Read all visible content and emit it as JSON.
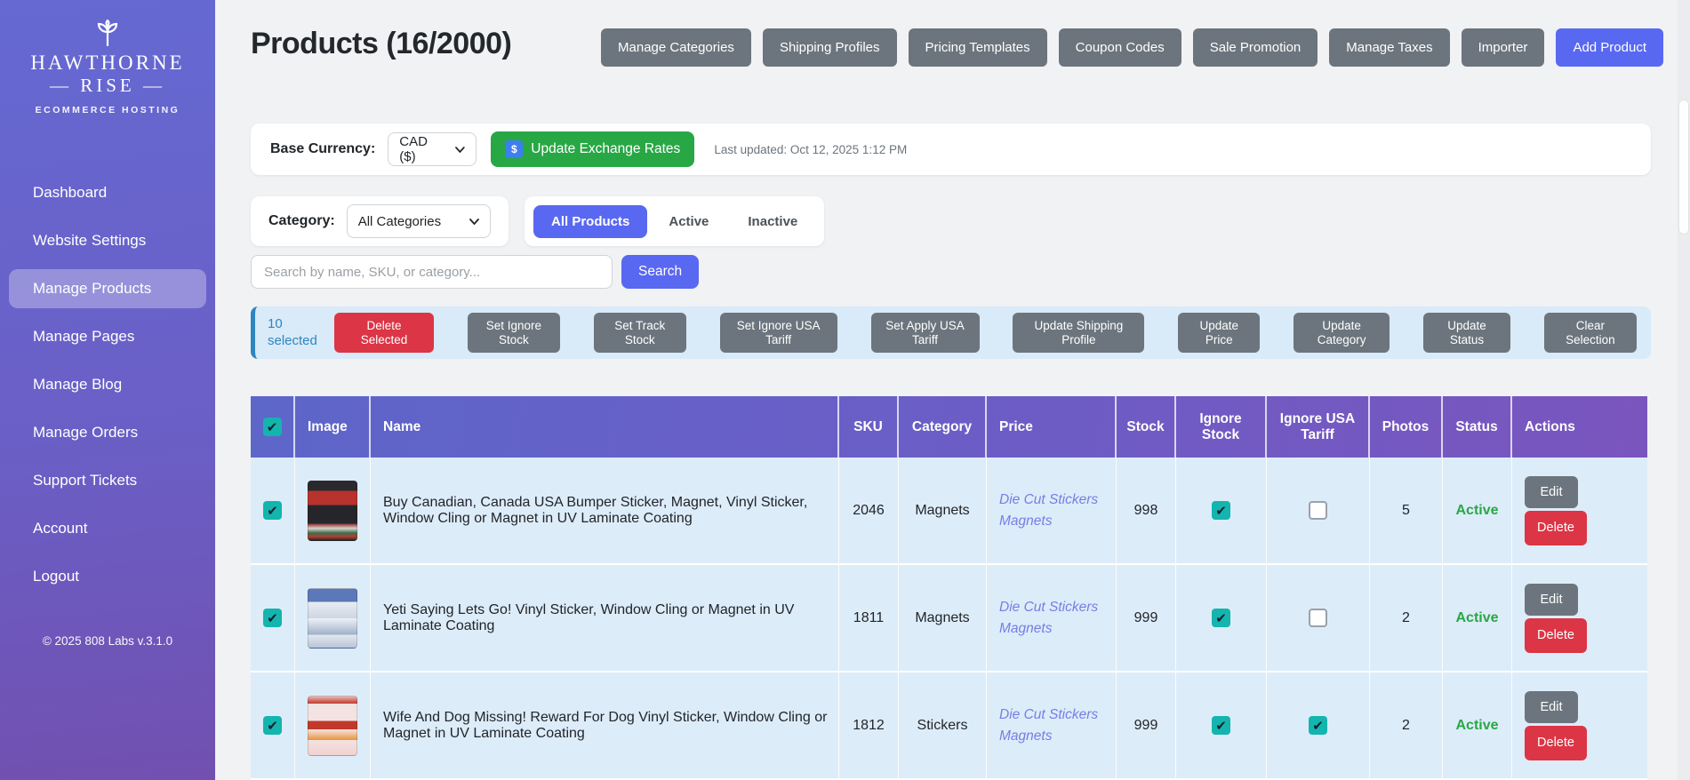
{
  "sidebar": {
    "logo": {
      "title_line1": "HAWTHORNE",
      "title_line2": "— RISE —",
      "subtitle": "ECOMMERCE HOSTING"
    },
    "items": [
      {
        "label": "Dashboard",
        "active": false
      },
      {
        "label": "Website Settings",
        "active": false
      },
      {
        "label": "Manage Products",
        "active": true
      },
      {
        "label": "Manage Pages",
        "active": false
      },
      {
        "label": "Manage Blog",
        "active": false
      },
      {
        "label": "Manage Orders",
        "active": false
      },
      {
        "label": "Support Tickets",
        "active": false
      },
      {
        "label": "Account",
        "active": false
      },
      {
        "label": "Logout",
        "active": false
      }
    ],
    "footer": "© 2025 808 Labs v.3.1.0"
  },
  "header": {
    "title": "Products (16/2000)",
    "buttons": [
      "Manage Categories",
      "Shipping Profiles",
      "Pricing Templates",
      "Coupon Codes",
      "Sale Promotion",
      "Manage Taxes",
      "Importer"
    ],
    "add_product_label": "Add Product"
  },
  "currency_bar": {
    "label": "Base Currency:",
    "selected": "CAD ($)",
    "update_button": "Update Exchange Rates",
    "fx_icon_glyph": "$",
    "last_updated": "Last updated: Oct 12, 2025 1:12 PM"
  },
  "filters": {
    "category_label": "Category:",
    "category_selected": "All Categories",
    "tabs": [
      {
        "label": "All Products",
        "active": true
      },
      {
        "label": "Active",
        "active": false
      },
      {
        "label": "Inactive",
        "active": false
      }
    ],
    "search_placeholder": "Search by name, SKU, or category...",
    "search_button": "Search"
  },
  "bulk_bar": {
    "selected_count": "10",
    "selected_word": "selected",
    "delete_button": "Delete Selected",
    "buttons": [
      "Set Ignore Stock",
      "Set Track Stock",
      "Set Ignore USA Tariff",
      "Set Apply USA Tariff",
      "Update Shipping Profile",
      "Update Price",
      "Update Category",
      "Update Status"
    ],
    "clear_button": "Clear Selection"
  },
  "table": {
    "columns": [
      "Image",
      "Name",
      "SKU",
      "Category",
      "Price",
      "Stock",
      "Ignore Stock",
      "Ignore USA Tariff",
      "Photos",
      "Status",
      "Actions"
    ],
    "header_checkbox_checked": true,
    "rows": [
      {
        "selected": true,
        "name": "Buy Canadian, Canada USA Bumper Sticker, Magnet, Vinyl Sticker, Window Cling or Magnet in UV Laminate Coating",
        "sku": "2046",
        "category": "Magnets",
        "price_link": "Die Cut Stickers Magnets",
        "stock": "998",
        "ignore_stock": true,
        "ignore_usa_tariff": false,
        "photos": "5",
        "status": "Active",
        "edit_label": "Edit",
        "delete_label": "Delete"
      },
      {
        "selected": true,
        "name": "Yeti Saying Lets Go! Vinyl Sticker, Window Cling or Magnet in UV Laminate Coating",
        "sku": "1811",
        "category": "Magnets",
        "price_link": "Die Cut Stickers Magnets",
        "stock": "999",
        "ignore_stock": true,
        "ignore_usa_tariff": false,
        "photos": "2",
        "status": "Active",
        "edit_label": "Edit",
        "delete_label": "Delete"
      },
      {
        "selected": true,
        "name": "Wife And Dog Missing! Reward For Dog Vinyl Sticker, Window Cling or Magnet in UV Laminate Coating",
        "sku": "1812",
        "category": "Stickers",
        "price_link": "Die Cut Stickers Magnets",
        "stock": "999",
        "ignore_stock": true,
        "ignore_usa_tariff": true,
        "photos": "2",
        "status": "Active",
        "edit_label": "Edit",
        "delete_label": "Delete"
      }
    ]
  },
  "colors": {
    "accent_blue": "#5968f1",
    "green": "#28a745",
    "red": "#dc3545",
    "gray": "#6c757d",
    "teal_checkbox": "#13b5ae",
    "bulk_blue": "#2e86c1",
    "row_selected_bg": "#ddecf9",
    "table_header_gradient": [
      "#5d66c9",
      "#7a55be"
    ],
    "sidebar_gradient": [
      "#6569d2",
      "#7150b0"
    ],
    "status_active": "#28a745"
  }
}
